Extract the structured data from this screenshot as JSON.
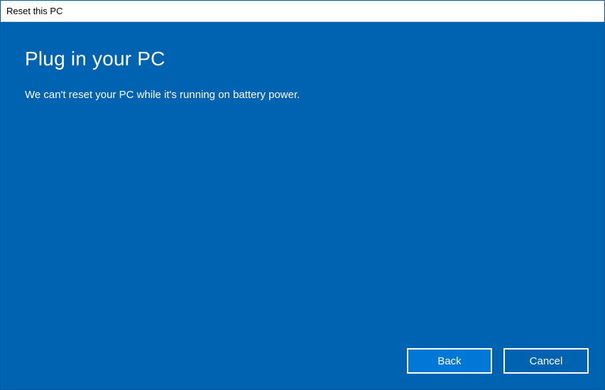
{
  "window": {
    "title": "Reset this PC"
  },
  "content": {
    "heading": "Plug in your PC",
    "message": "We can't reset your PC while it's running on battery power."
  },
  "buttons": {
    "back": "Back",
    "cancel": "Cancel"
  }
}
